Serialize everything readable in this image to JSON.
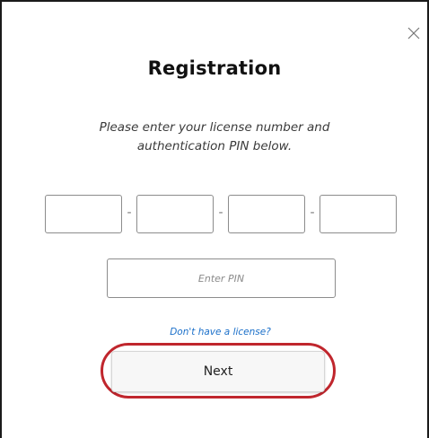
{
  "dialog": {
    "title": "Registration",
    "instructions_line1": "Please enter your license number and",
    "instructions_line2": "authentication PIN below.",
    "license_segments": [
      "",
      "",
      "",
      ""
    ],
    "separator": "-",
    "pin_placeholder": "Enter PIN",
    "no_license_link": "Don't have a license?",
    "next_label": "Next",
    "close_icon": "close-icon",
    "colors": {
      "link": "#1a6fc9",
      "highlight_ring": "#c0262d"
    }
  }
}
